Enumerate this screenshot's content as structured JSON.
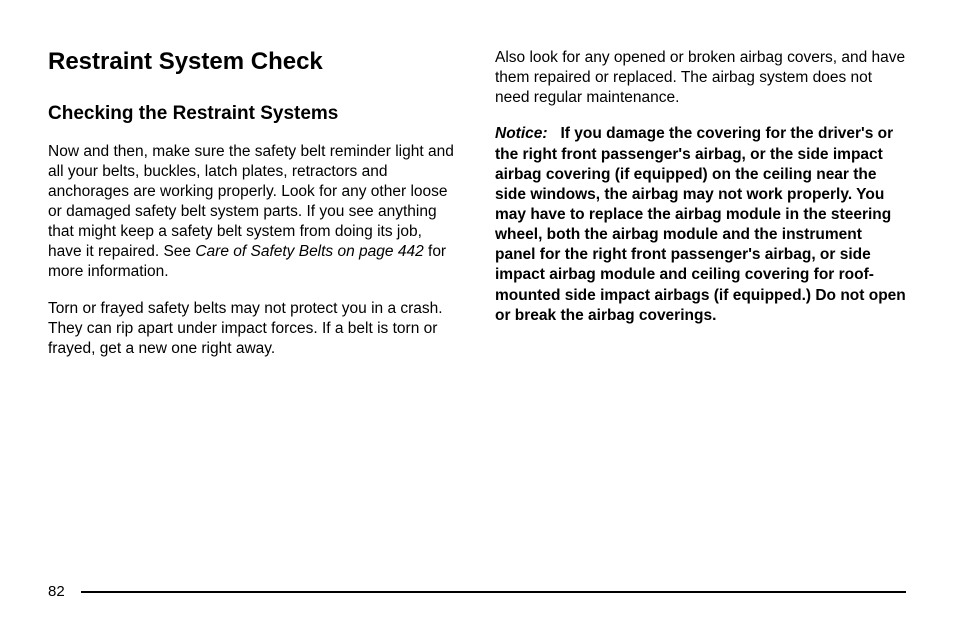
{
  "headings": {
    "main": "Restraint System Check",
    "sub": "Checking the Restraint Systems"
  },
  "left_column": {
    "p1_a": "Now and then, make sure the safety belt reminder light and all your belts, buckles, latch plates, retractors and anchorages are working properly. Look for any other loose or damaged safety belt system parts. If you see anything that might keep a safety belt system from doing its job, have it repaired. See ",
    "p1_ref": "Care of Safety Belts on page 442",
    "p1_b": " for more information.",
    "p2": "Torn or frayed safety belts may not protect you in a crash. They can rip apart under impact forces. If a belt is torn or frayed, get a new one right away."
  },
  "right_column": {
    "p1": "Also look for any opened or broken airbag covers, and have them repaired or replaced. The airbag system does not need regular maintenance.",
    "p2_label": "Notice:",
    "p2_body": "If you damage the covering for the driver's or the right front passenger's airbag, or the side impact airbag covering (if equipped) on the ceiling near the side windows, the airbag may not work properly. You may have to replace the airbag module in the steering wheel, both the airbag module and the instrument panel for the right front passenger's airbag, or side impact airbag module and ceiling covering for roof-mounted side impact airbags (if equipped.) Do not open or break the airbag coverings."
  },
  "page_number": "82"
}
